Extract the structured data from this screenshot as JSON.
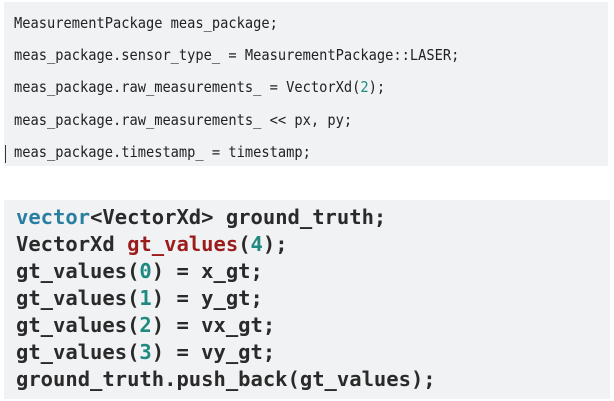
{
  "code_block_1": {
    "lines": [
      {
        "text": "MeasurementPackage meas_package;"
      },
      {
        "text": "meas_package.sensor_type_ = MeasurementPackage::LASER;"
      },
      {
        "pre": "meas_package.raw_measurements_ = VectorXd(",
        "num": "2",
        "post": ");"
      },
      {
        "text": "meas_package.raw_measurements_ << px, py;"
      },
      {
        "text": "meas_package.timestamp_ = timestamp;"
      }
    ]
  },
  "code_block_2": {
    "line1": {
      "kw": "vector",
      "rest": "<VectorXd> ground_truth;"
    },
    "line2": {
      "pre": "VectorXd ",
      "fn": "gt_values",
      "mid": "(",
      "num": "4",
      "post": ");"
    },
    "line3": {
      "pre": "gt_values(",
      "num": "0",
      "post": ") = x_gt;"
    },
    "line4": {
      "pre": "gt_values(",
      "num": "1",
      "post": ") = y_gt;"
    },
    "line5": {
      "pre": "gt_values(",
      "num": "2",
      "post": ") = vx_gt;"
    },
    "line6": {
      "pre": "gt_values(",
      "num": "3",
      "post": ") = vy_gt;"
    },
    "line7": {
      "text": "ground_truth.push_back(gt_values);"
    }
  },
  "colors": {
    "background": "#f1f2f4",
    "keyword": "#2a7fa0",
    "number": "#1f8a80",
    "function_name": "#9b1c1c"
  }
}
